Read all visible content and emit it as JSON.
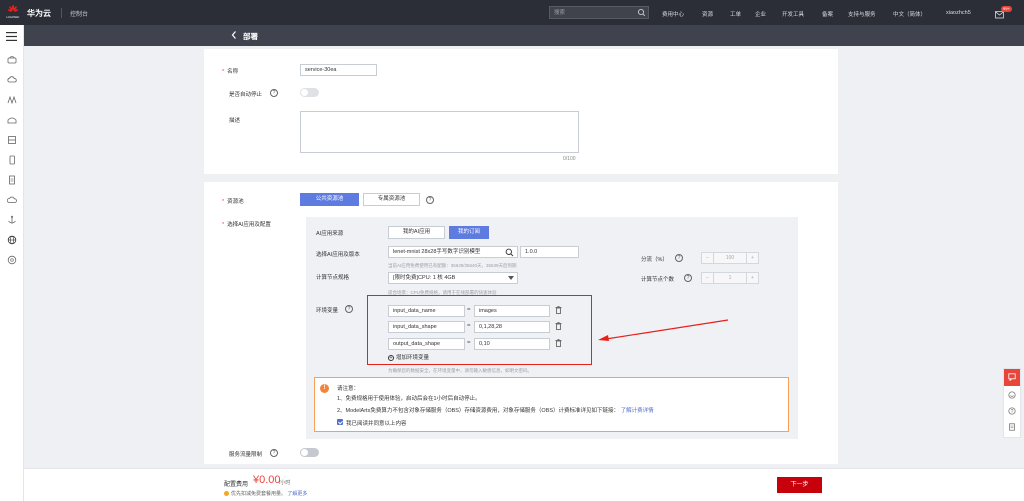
{
  "topbar": {
    "logo_text": "HUAWEI",
    "brand": "华为云",
    "console": "控制台",
    "search_placeholder": "搜索",
    "nav": [
      "费用中心",
      "资源",
      "工单",
      "企业",
      "开发工具",
      "备案",
      "支持与服务",
      "中文（简体）",
      "xiaozhch5"
    ],
    "message_badge": "99+"
  },
  "page": {
    "title": "部署"
  },
  "basic": {
    "name_label": "名称",
    "name_value": "service-30ea",
    "autostop_label": "是否自动停止",
    "desc_label": "描述",
    "desc_counter": "0/100"
  },
  "resource": {
    "pool_label": "资源池",
    "pool_tabs": [
      "公共资源池",
      "专属资源池"
    ],
    "model_label": "选择AI应用及配置",
    "source_label": "AI应用来源",
    "source_tabs": [
      "我的AI应用",
      "我的订阅"
    ],
    "select_label": "选择AI应用及版本",
    "model_value": "lenet-mnist 28x28手写数字识别模型",
    "version_value": "1.0.0",
    "quota_hint": "当前AI应用免费使用已有配额：35639/35640天，35639天后到期",
    "spec_label": "计算节点规格",
    "spec_value": "[限时免费]CPU: 1 核 4GB",
    "spec_hint": "适合场景：CPU免费规格，请用于在线部署的快速体验",
    "traffic_label": "分流（%）",
    "traffic_value": "100",
    "nodes_label": "计算节点个数",
    "nodes_value": "1",
    "env_label": "环境变量",
    "env": [
      {
        "key": "input_data_name",
        "value": "images"
      },
      {
        "key": "input_data_shape",
        "value": "0,1,28,28"
      },
      {
        "key": "output_data_shape",
        "value": "0,10"
      }
    ],
    "add_env": "增加环境变量",
    "env_hint": "为确保您的数据安全，在环境变量中，请勿输入敏感信息，如明文密码。"
  },
  "notice": {
    "title": "请注意：",
    "line1": "1、免费规格用于使用体验，启动后会在1小时后自动停止。",
    "line2": "2、ModelArts免费算力不包含对象存储服务（OBS）存储资源费用，对象存储服务（OBS）计费标准详见如下链接：",
    "link": "了解计费详情",
    "agree": "我已阅读并同意以上内容"
  },
  "traffic_limit": {
    "label": "服务流量限制"
  },
  "footer": {
    "fee_label": "配置费用",
    "fee_value": "¥0.00",
    "fee_unit": "/小时",
    "note": "优先扣减免费套餐用量。",
    "note_link": "了解更多",
    "next": "下一步"
  }
}
